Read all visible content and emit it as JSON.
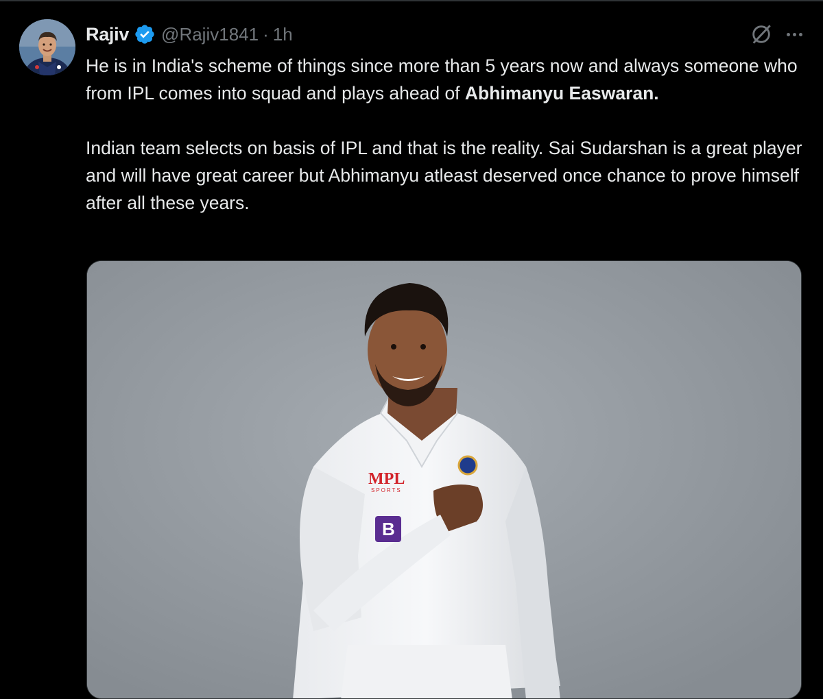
{
  "tweet": {
    "author_name": "Rajiv",
    "author_handle": "@Rajiv1841",
    "separator": "·",
    "time": "1h",
    "paragraph1_part1": "He is in India's scheme of things since more than 5 years now and always someone who from IPL comes into squad and plays ahead of ",
    "paragraph1_bold": "Abhimanyu Easwaran.",
    "paragraph2": "Indian team selects on basis of IPL and that is the reality. Sai Sudarshan is a great player and will have great career but Abhimanyu atleast deserved once chance to prove himself after all these years.",
    "media": {
      "jersey_text": "MPL",
      "jersey_subtext": "SPORTS",
      "sponsor_letter": "B"
    }
  },
  "icons": {
    "verified": "verified-badge-icon",
    "grok": "grok-icon",
    "more": "more-icon"
  },
  "colors": {
    "background": "#000000",
    "text": "#e7e9ea",
    "secondary_text": "#71767b",
    "verified_blue": "#1d9bf0",
    "media_background": "#8f959b"
  }
}
